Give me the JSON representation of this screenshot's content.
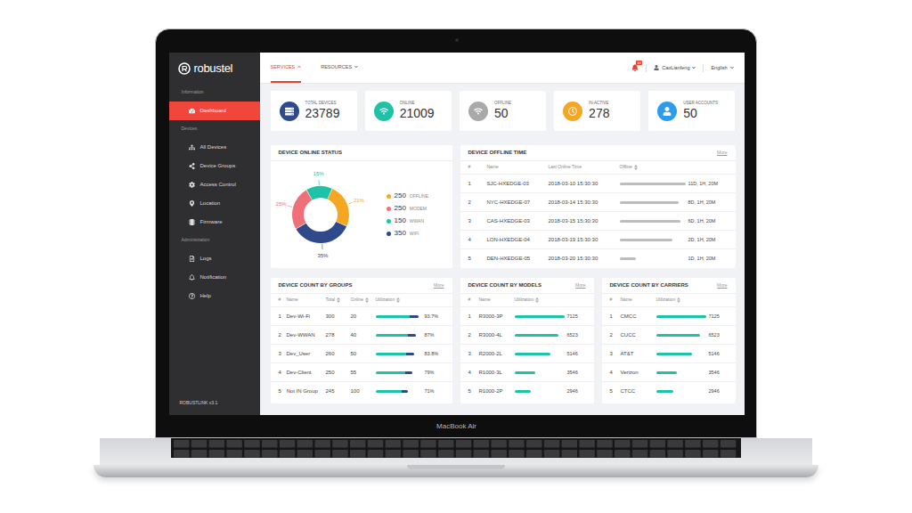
{
  "device": {
    "label": "MacBook Air"
  },
  "sidebar": {
    "logo": "robustel",
    "sections": [
      {
        "label": "Information",
        "items": [
          {
            "label": "Dashboard",
            "selected": true
          }
        ]
      },
      {
        "label": "Devices",
        "items": [
          {
            "label": "All Devices",
            "selected": false
          },
          {
            "label": "Device Groups",
            "selected": false
          },
          {
            "label": "Access Control",
            "selected": false
          },
          {
            "label": "Location",
            "selected": false
          },
          {
            "label": "Firmware",
            "selected": false
          }
        ]
      },
      {
        "label": "Administration",
        "items": [
          {
            "label": "Logs",
            "selected": false
          },
          {
            "label": "Notification",
            "selected": false
          },
          {
            "label": "Help",
            "selected": false
          }
        ]
      }
    ],
    "version": "ROBUSTLINK v3.1"
  },
  "topbar": {
    "tabs": [
      {
        "label": "SERVICES",
        "selected": true
      },
      {
        "label": "RESOURCES",
        "selected": false
      }
    ],
    "notifications": "10",
    "user": "CaoLianfeng",
    "language": "English"
  },
  "stats": [
    {
      "label": "TOTAL DEVICES",
      "value": "23789",
      "color": "#2e4a8a"
    },
    {
      "label": "ONLINE",
      "value": "21009",
      "color": "#1ec2a6"
    },
    {
      "label": "OFFLINE",
      "value": "50",
      "color": "#a9a9a9"
    },
    {
      "label": "IN-ACTIVE",
      "value": "278",
      "color": "#f5a623"
    },
    {
      "label": "USER ACCOUNTS",
      "value": "50",
      "color": "#2d9cf0"
    }
  ],
  "online_status": {
    "title": "DEVICE ONLINE STATUS",
    "segments": [
      {
        "label": "15%",
        "value": 150,
        "color": "#1ec2a6"
      },
      {
        "label": "21%",
        "value": 250,
        "color": "#f5a623"
      },
      {
        "label": "35%",
        "value": 350,
        "color": "#2e4a8a"
      },
      {
        "label": "25%",
        "value": 250,
        "color": "#f0707a"
      }
    ],
    "legend": [
      {
        "count": "250",
        "label": "OFFLINE",
        "color": "#f5a623"
      },
      {
        "count": "250",
        "label": "MODEM",
        "color": "#f0707a"
      },
      {
        "count": "150",
        "label": "WWAN",
        "color": "#1ec2a6"
      },
      {
        "count": "350",
        "label": "WIFI",
        "color": "#2e4a8a"
      }
    ]
  },
  "offline_time": {
    "title": "DEVICE OFFLINE TIME",
    "more": "More",
    "columns": [
      {
        "label": "#",
        "sortable": false
      },
      {
        "label": "Name",
        "sortable": false
      },
      {
        "label": "Last Online Time",
        "sortable": false
      },
      {
        "label": "Offline",
        "sortable": true
      }
    ],
    "rows": [
      {
        "index": "1",
        "name": "SJC-HXEDGE-03",
        "last_online": "2018-03-10 15:30:30",
        "offline": "11D, 1H, 20M",
        "level": 1.0
      },
      {
        "index": "2",
        "name": "NYC-HXEDGE-07",
        "last_online": "2018-03-14 15:30:30",
        "offline": "8D, 1H, 20M",
        "level": 0.9
      },
      {
        "index": "3",
        "name": "CAS-HXEDGE-03",
        "last_online": "2018-03-15 15:30:30",
        "offline": "6D, 1H, 20M",
        "level": 0.92
      },
      {
        "index": "4",
        "name": "LON-HXEDGE-04",
        "last_online": "2018-03-19 15:30:30",
        "offline": "2D, 1H, 20M",
        "level": 0.8
      },
      {
        "index": "5",
        "name": "DEN-HXEDGE-05",
        "last_online": "2018-03-20 15:30:30",
        "offline": "1D, 1H, 20M",
        "level": 0.25
      }
    ]
  },
  "groups": {
    "title": "DEVICE COUNT BY GROUPS",
    "more": "More",
    "columns": [
      {
        "label": "#",
        "sortable": false
      },
      {
        "label": "Name",
        "sortable": false
      },
      {
        "label": "Total",
        "sortable": true
      },
      {
        "label": "Online",
        "sortable": true
      },
      {
        "label": "Utilization",
        "sortable": true
      }
    ],
    "rows": [
      {
        "index": "1",
        "name": "Dev-Wi-Fi",
        "total": "300",
        "online": "20",
        "utilization": "93.7%",
        "level": 0.937
      },
      {
        "index": "2",
        "name": "Dev-WWAN",
        "total": "278",
        "online": "40",
        "utilization": "87%",
        "level": 0.87
      },
      {
        "index": "3",
        "name": "Dev_User",
        "total": "260",
        "online": "50",
        "utilization": "83.8%",
        "level": 0.838
      },
      {
        "index": "4",
        "name": "Dev-Client",
        "total": "250",
        "online": "55",
        "utilization": "79%",
        "level": 0.79
      },
      {
        "index": "5",
        "name": "Not IN Group",
        "total": "245",
        "online": "100",
        "utilization": "71%",
        "level": 0.71
      }
    ]
  },
  "models": {
    "title": "DEVICE COUNT BY MODELS",
    "more": "More",
    "columns": [
      {
        "label": "#",
        "sortable": false
      },
      {
        "label": "Name",
        "sortable": false
      },
      {
        "label": "Utilization",
        "sortable": true
      }
    ],
    "rows": [
      {
        "index": "1",
        "name": "R3000-3P",
        "count": "7125",
        "level": 1.0
      },
      {
        "index": "2",
        "name": "R3000-4L",
        "count": "6523",
        "level": 0.88
      },
      {
        "index": "3",
        "name": "R2000-2L",
        "count": "5146",
        "level": 0.72
      },
      {
        "index": "4",
        "name": "R1000-3L",
        "count": "3546",
        "level": 0.42
      },
      {
        "index": "5",
        "name": "R1000-2P",
        "count": "2946",
        "level": 0.33
      }
    ]
  },
  "carriers": {
    "title": "DEVICE COUNT BY CARRIERS",
    "more": "More",
    "columns": [
      {
        "label": "#",
        "sortable": false
      },
      {
        "label": "Name",
        "sortable": false
      },
      {
        "label": "Utilization",
        "sortable": true
      }
    ],
    "rows": [
      {
        "index": "1",
        "name": "CMCC",
        "count": "7125",
        "level": 1.0
      },
      {
        "index": "2",
        "name": "CUCC",
        "count": "6523",
        "level": 0.88
      },
      {
        "index": "3",
        "name": "AT&T",
        "count": "5146",
        "level": 0.72
      },
      {
        "index": "4",
        "name": "Verizon",
        "count": "3546",
        "level": 0.42
      },
      {
        "index": "5",
        "name": "CTCC",
        "count": "2946",
        "level": 0.35
      }
    ]
  }
}
